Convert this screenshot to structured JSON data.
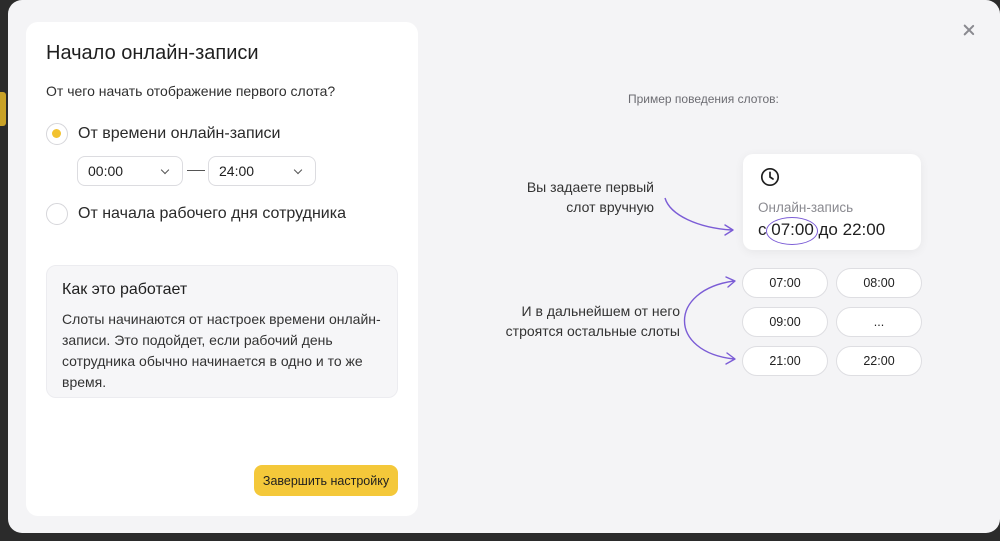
{
  "modal": {
    "title": "Начало онлайн-записи",
    "question": "От чего начать отображение первого слота?",
    "options": [
      {
        "label": "От времени онлайн-записи",
        "checked": true
      },
      {
        "label": "От начала рабочего дня сотрудника",
        "checked": false
      }
    ],
    "time_from": "00:00",
    "time_to": "24:00",
    "info": {
      "title": "Как это работает",
      "text": "Слоты начинаются от настроек времени онлайн-записи. Это подойдет, если рабочий день сотрудника обычно начинается в одно и то же время."
    },
    "finish_label": "Завершить настройку"
  },
  "example": {
    "caption": "Пример поведения слотов:",
    "annot_first_line1": "Вы задаете первый",
    "annot_first_line2": "слот вручную",
    "annot_rest_line1": "И в дальнейшем от него",
    "annot_rest_line2": "строятся остальные слоты",
    "card_label": "Онлайн-запись",
    "card_prefix": "с",
    "card_start": "07:00",
    "card_suffix": "до 22:00",
    "slots": [
      "07:00",
      "08:00",
      "09:00",
      "...",
      "21:00",
      "22:00"
    ]
  },
  "colors": {
    "accent": "#f2c230",
    "button": "#f4c83a",
    "highlight": "#7b5cd6"
  },
  "icons": [
    "close-icon",
    "clock-icon",
    "chevron-down-icon"
  ]
}
